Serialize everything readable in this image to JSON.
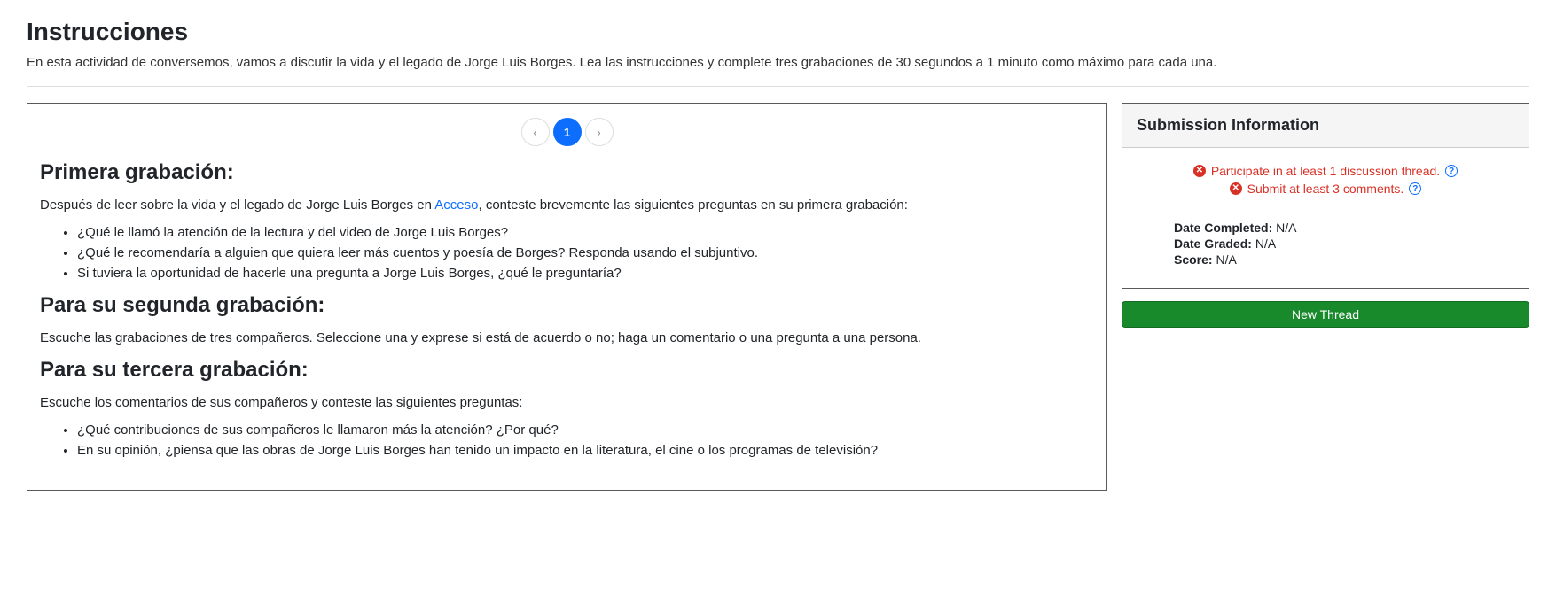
{
  "header": {
    "title": "Instrucciones",
    "description": "En esta actividad de conversemos, vamos a discutir la vida y el legado de Jorge Luis Borges. Lea las instrucciones y complete tres grabaciones de 30 segundos a 1 minuto como máximo para cada una."
  },
  "pager": {
    "prev": "‹",
    "current": "1",
    "next": "›"
  },
  "sections": {
    "first": {
      "title": "Primera grabación:",
      "intro_pre": "Después de leer sobre la vida y el legado de Jorge Luis Borges en ",
      "link": "Acceso",
      "intro_post": ", conteste brevemente las siguientes preguntas en su primera grabación:",
      "items": [
        "¿Qué le llamó la atención de la lectura y del video de Jorge Luis Borges?",
        "¿Qué le recomendaría a alguien que quiera leer más cuentos y poesía de Borges? Responda usando el subjuntivo.",
        "Si tuviera la oportunidad de hacerle una pregunta a Jorge Luis Borges, ¿qué le preguntaría?"
      ]
    },
    "second": {
      "title": "Para su segunda grabación:",
      "text": "Escuche las grabaciones de tres compañeros. Seleccione una y exprese si está de acuerdo o no; haga un comentario o una pregunta a una persona."
    },
    "third": {
      "title": "Para su tercera grabación:",
      "text": "Escuche los comentarios de sus compañeros y conteste las siguientes preguntas:",
      "items": [
        "¿Qué contribuciones de sus compañeros le llamaron más la atención? ¿Por qué?",
        "En su opinión, ¿piensa que las obras de Jorge Luis Borges han tenido un impacto en la literatura, el cine o los programas de televisión?"
      ]
    }
  },
  "submission": {
    "title": "Submission Information",
    "requirements": [
      "Participate in at least 1 discussion thread.",
      "Submit at least 3 comments."
    ],
    "labels": {
      "date_completed": "Date Completed:",
      "date_graded": "Date Graded:",
      "score": "Score:"
    },
    "values": {
      "date_completed": "N/A",
      "date_graded": "N/A",
      "score": "N/A"
    },
    "new_thread": "New Thread"
  }
}
